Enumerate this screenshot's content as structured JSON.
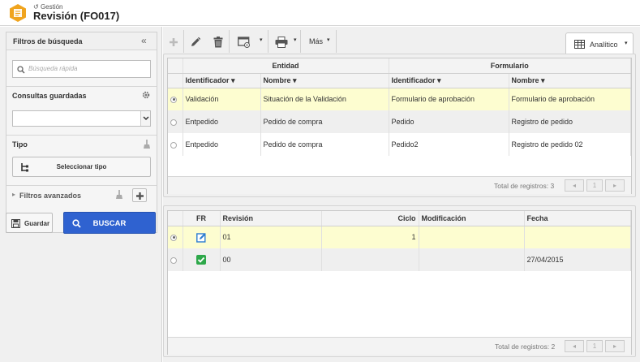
{
  "header": {
    "breadcrumb": "Gestión",
    "title": "Revisión (FO017)"
  },
  "filters": {
    "title": "Filtros de búsqueda",
    "quick_search_placeholder": "Búsqueda rápida",
    "saved_queries_label": "Consultas guardadas",
    "type_label": "Tipo",
    "select_type_label": "Seleccionar tipo",
    "advanced_label": "Filtros avanzados",
    "save_label": "Guardar",
    "search_label": "BUSCAR"
  },
  "toolbar": {
    "more_label": "Más",
    "view_label": "Analítico"
  },
  "top_grid": {
    "group1": "Entidad",
    "group2": "Formulario",
    "columns": [
      "Identificador",
      "Nombre",
      "Identificador",
      "Nombre"
    ],
    "rows": [
      {
        "selected": true,
        "cells": [
          "Validación",
          "Situación de la Validación",
          "Formulario de aprobación",
          "Formulario de aprobación"
        ]
      },
      {
        "selected": false,
        "cells": [
          "Entpedido",
          "Pedido de compra",
          "Pedido",
          "Registro de pedido"
        ]
      },
      {
        "selected": false,
        "cells": [
          "Entpedido",
          "Pedido de compra",
          "Pedido2",
          "Registro de pedido 02"
        ]
      }
    ],
    "total": "Total de registros: 3",
    "page": "1"
  },
  "bottom_grid": {
    "columns": [
      "FR",
      "Revisión",
      "Ciclo",
      "Modificación",
      "Fecha"
    ],
    "rows": [
      {
        "selected": true,
        "icon": "edit-icon",
        "cells": [
          "01",
          "1",
          "",
          ""
        ]
      },
      {
        "selected": false,
        "icon": "check-icon",
        "cells": [
          "00",
          "",
          "",
          "27/04/2015"
        ]
      }
    ],
    "total": "Total de registros: 2",
    "page": "1"
  },
  "colors": {
    "accent": "#2f62d0",
    "logo": "#f0a41e",
    "selected_row": "#fdfdd0"
  }
}
